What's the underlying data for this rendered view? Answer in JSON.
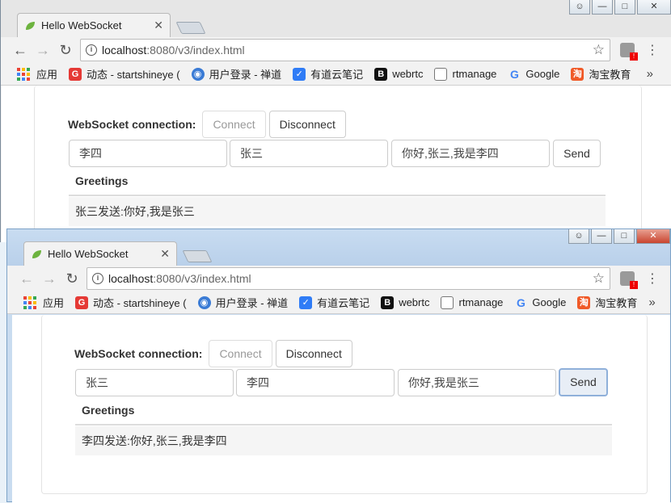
{
  "window_back": {
    "tab_title": "Hello WebSocket",
    "url_host": "localhost",
    "url_path": ":8080/v3/index.html",
    "connection_label": "WebSocket connection:",
    "connect_label": "Connect",
    "disconnect_label": "Disconnect",
    "from_value": "李四",
    "to_value": "张三",
    "message_value": "你好,张三,我是李四",
    "send_label": "Send",
    "greetings_header": "Greetings",
    "greetings": [
      "张三发送:你好,我是张三"
    ]
  },
  "window_front": {
    "tab_title": "Hello WebSocket",
    "url_host": "localhost",
    "url_path": ":8080/v3/index.html",
    "connection_label": "WebSocket connection:",
    "connect_label": "Connect",
    "disconnect_label": "Disconnect",
    "from_value": "张三",
    "to_value": "李四",
    "message_value": "你好,我是张三",
    "send_label": "Send",
    "greetings_header": "Greetings",
    "greetings": [
      "李四发送:你好,张三,我是李四"
    ]
  },
  "bookmarks": {
    "apps": "应用",
    "items": [
      "动态 - startshineye (",
      "用户登录 - 禅道",
      "有道云笔记",
      "webrtc",
      "rtmanage",
      "Google",
      "淘宝教育"
    ],
    "more": "»"
  },
  "colors": {
    "brand_red": "#e53935",
    "youdao_blue": "#2f7cf6",
    "taobao_orange": "#f05a28"
  }
}
